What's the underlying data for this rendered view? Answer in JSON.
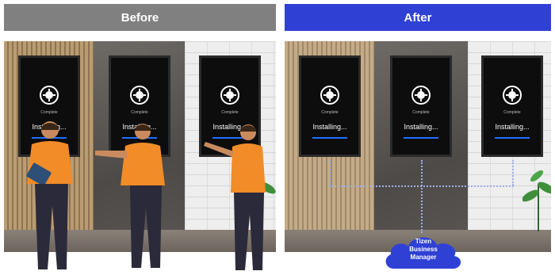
{
  "banners": {
    "before": "Before",
    "after": "After"
  },
  "display": {
    "complete": "Complete",
    "installing": "Installing..."
  },
  "cloud": {
    "line1": "Tizen",
    "line2": "Business",
    "line3": "Manager"
  },
  "colors": {
    "before_banner": "#808080",
    "after_banner": "#2f41d4",
    "progress": "#1f6fff",
    "shirt": "#f28c28"
  }
}
